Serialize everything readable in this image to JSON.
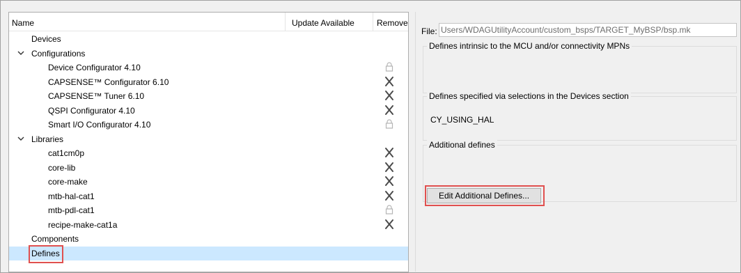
{
  "tree": {
    "columns": {
      "name": "Name",
      "update": "Update Available",
      "remove": "Remove"
    },
    "rows": [
      {
        "label": "Devices",
        "level": 0,
        "expander": null,
        "remove": null
      },
      {
        "label": "Configurations",
        "level": 0,
        "expander": "expanded",
        "remove": null
      },
      {
        "label": "Device Configurator 4.10",
        "level": 1,
        "expander": null,
        "remove": "lock"
      },
      {
        "label": "CAPSENSE™ Configurator 6.10",
        "level": 1,
        "expander": null,
        "remove": "x"
      },
      {
        "label": "CAPSENSE™ Tuner 6.10",
        "level": 1,
        "expander": null,
        "remove": "x"
      },
      {
        "label": "QSPI Configurator 4.10",
        "level": 1,
        "expander": null,
        "remove": "x"
      },
      {
        "label": "Smart I/O Configurator 4.10",
        "level": 1,
        "expander": null,
        "remove": "lock"
      },
      {
        "label": "Libraries",
        "level": 0,
        "expander": "expanded",
        "remove": null
      },
      {
        "label": "cat1cm0p",
        "level": 1,
        "expander": null,
        "remove": "x"
      },
      {
        "label": "core-lib",
        "level": 1,
        "expander": null,
        "remove": "x"
      },
      {
        "label": "core-make",
        "level": 1,
        "expander": null,
        "remove": "x"
      },
      {
        "label": "mtb-hal-cat1",
        "level": 1,
        "expander": null,
        "remove": "x"
      },
      {
        "label": "mtb-pdl-cat1",
        "level": 1,
        "expander": null,
        "remove": "lock"
      },
      {
        "label": "recipe-make-cat1a",
        "level": 1,
        "expander": null,
        "remove": "x"
      },
      {
        "label": "Components",
        "level": 0,
        "expander": null,
        "remove": null
      },
      {
        "label": "Defines",
        "level": 0,
        "expander": null,
        "remove": null,
        "selected": true
      }
    ]
  },
  "details": {
    "file_label": "File:",
    "file_path": "Users/WDAGUtilityAccount/custom_bsps/TARGET_MyBSP/bsp.mk",
    "intrinsic_title": "Defines intrinsic to the MCU and/or connectivity MPNs",
    "devices_title": "Defines specified via selections in the Devices section",
    "devices_value": "CY_USING_HAL",
    "additional_title": "Additional defines",
    "edit_button": "Edit Additional Defines..."
  },
  "colors": {
    "selection": "#cce8ff",
    "highlight": "#e0504f",
    "icon": "#4a4a4a",
    "lock": "#b5b5b5"
  }
}
